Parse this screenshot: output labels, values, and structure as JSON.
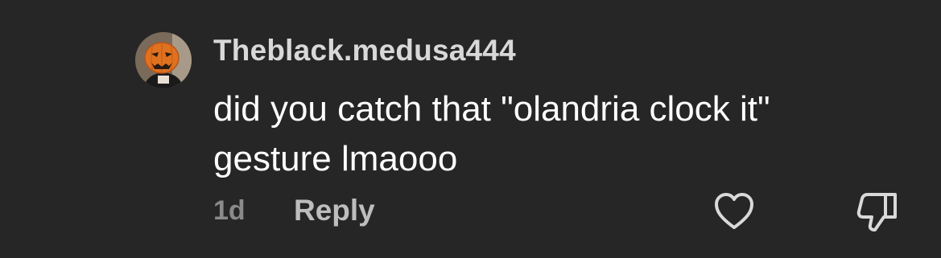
{
  "comment": {
    "username": "Theblack.medusa444",
    "text": "did you catch that \"olandria clock it\" gesture lmaooo",
    "timestamp": "1d",
    "reply_label": "Reply"
  },
  "icons": {
    "avatar": "pumpkin-mask-avatar",
    "like": "heart-icon",
    "dislike": "thumbs-down-icon"
  },
  "colors": {
    "background": "#262626",
    "username": "#d8d8d8",
    "text": "#ffffff",
    "muted": "#8a8a8a"
  }
}
